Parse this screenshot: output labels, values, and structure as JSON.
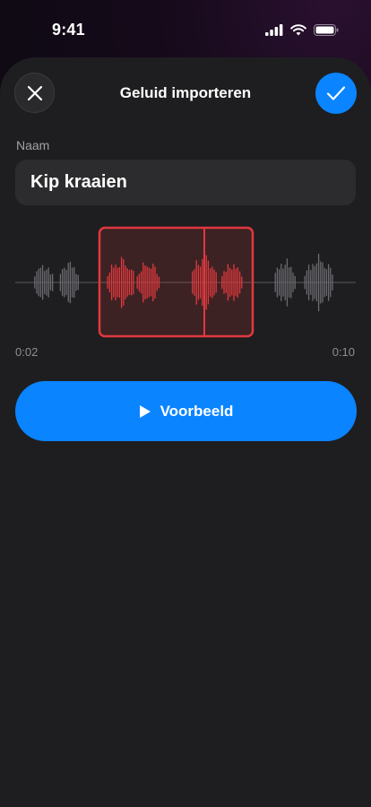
{
  "status_bar": {
    "time": "9:41"
  },
  "header": {
    "title": "Geluid importeren"
  },
  "form": {
    "name_label": "Naam",
    "name_value": "Kip kraaien"
  },
  "trim": {
    "start_time": "0:02",
    "end_time": "0:10"
  },
  "actions": {
    "preview_label": "Voorbeeld"
  },
  "colors": {
    "accent": "#0a84ff",
    "selection": "#e0393e",
    "waveform": "#6b6b70"
  }
}
